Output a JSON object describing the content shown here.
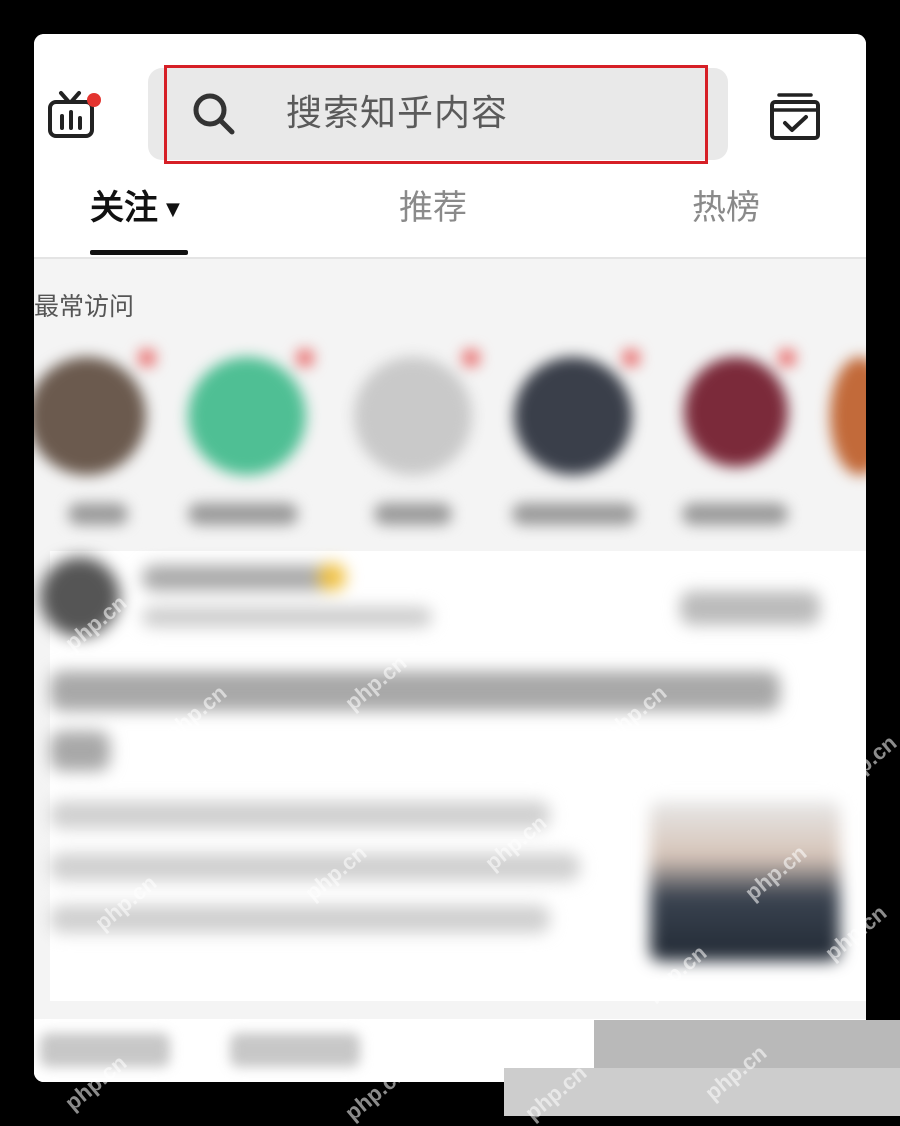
{
  "search": {
    "placeholder": "搜索知乎内容"
  },
  "tabs": [
    {
      "label": "关注",
      "active": true
    },
    {
      "label": "推荐",
      "active": false
    },
    {
      "label": "热榜",
      "active": false
    }
  ],
  "section": {
    "title": "最常访问"
  },
  "watermark": "php.cn",
  "colors": {
    "highlight": "#d61f26",
    "notification_dot": "#e3342f",
    "active_tab": "#111111",
    "inactive_tab": "#8a8a8a"
  },
  "icons": [
    "tv-icon",
    "search-icon",
    "calendar-check-icon"
  ]
}
